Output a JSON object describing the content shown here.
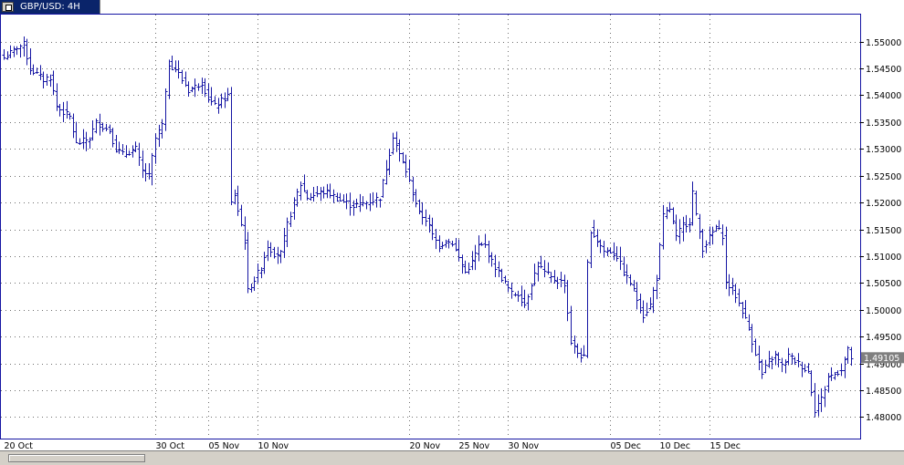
{
  "window": {
    "title": "GBP/USD: 4H"
  },
  "colors": {
    "bars": "#1515a3",
    "grid": "#6f6f6f",
    "frame": "#1515a3",
    "price_box": "#7f7f7f"
  },
  "chart_data": {
    "type": "ohlc",
    "symbol": "GBP/USD",
    "timeframe": "4H",
    "current_price_label": "1.49105",
    "current_price": 1.49105,
    "ylim": [
      1.477,
      1.553
    ],
    "y_ticks": [
      "1.55000",
      "1.54500",
      "1.54000",
      "1.53500",
      "1.53000",
      "1.52500",
      "1.52000",
      "1.51500",
      "1.51000",
      "1.50500",
      "1.50000",
      "1.49500",
      "1.49000",
      "1.48500",
      "1.48000"
    ],
    "x_labels": [
      {
        "label": "20 Oct",
        "bar": 0
      },
      {
        "label": "30 Oct",
        "bar": 46
      },
      {
        "label": "05 Nov",
        "bar": 62
      },
      {
        "label": "10 Nov",
        "bar": 77
      },
      {
        "label": "20 Nov",
        "bar": 123
      },
      {
        "label": "25 Nov",
        "bar": 138
      },
      {
        "label": "30 Nov",
        "bar": 153
      },
      {
        "label": "05 Dec",
        "bar": 184
      },
      {
        "label": "10 Dec",
        "bar": 199
      },
      {
        "label": "15 Dec",
        "bar": 214
      }
    ],
    "close_path": [
      [
        0,
        1.547
      ],
      [
        4,
        1.549
      ],
      [
        6,
        1.5495
      ],
      [
        8,
        1.545
      ],
      [
        12,
        1.543
      ],
      [
        14,
        1.5435
      ],
      [
        16,
        1.538
      ],
      [
        20,
        1.536
      ],
      [
        22,
        1.531
      ],
      [
        26,
        1.532
      ],
      [
        28,
        1.535
      ],
      [
        32,
        1.5335
      ],
      [
        34,
        1.53
      ],
      [
        36,
        1.529
      ],
      [
        40,
        1.53
      ],
      [
        42,
        1.526
      ],
      [
        44,
        1.525
      ],
      [
        46,
        1.532
      ],
      [
        48,
        1.5345
      ],
      [
        50,
        1.546
      ],
      [
        52,
        1.545
      ],
      [
        54,
        1.543
      ],
      [
        56,
        1.541
      ],
      [
        60,
        1.5425
      ],
      [
        62,
        1.5395
      ],
      [
        64,
        1.538
      ],
      [
        68,
        1.54
      ],
      [
        69,
        1.52
      ],
      [
        70,
        1.5215
      ],
      [
        73,
        1.513
      ],
      [
        74,
        1.5035
      ],
      [
        78,
        1.508
      ],
      [
        80,
        1.512
      ],
      [
        82,
        1.5105
      ],
      [
        84,
        1.5105
      ],
      [
        86,
        1.516
      ],
      [
        88,
        1.52
      ],
      [
        90,
        1.5235
      ],
      [
        92,
        1.521
      ],
      [
        96,
        1.522
      ],
      [
        98,
        1.522
      ],
      [
        102,
        1.5205
      ],
      [
        106,
        1.5195
      ],
      [
        110,
        1.52
      ],
      [
        114,
        1.521
      ],
      [
        116,
        1.5265
      ],
      [
        118,
        1.5325
      ],
      [
        120,
        1.529
      ],
      [
        122,
        1.526
      ],
      [
        126,
        1.518
      ],
      [
        128,
        1.517
      ],
      [
        130,
        1.514
      ],
      [
        132,
        1.512
      ],
      [
        134,
        1.513
      ],
      [
        136,
        1.5125
      ],
      [
        140,
        1.507
      ],
      [
        142,
        1.509
      ],
      [
        144,
        1.512
      ],
      [
        146,
        1.512
      ],
      [
        148,
        1.509
      ],
      [
        150,
        1.507
      ],
      [
        154,
        1.503
      ],
      [
        156,
        1.503
      ],
      [
        158,
        1.501
      ],
      [
        160,
        1.505
      ],
      [
        162,
        1.5085
      ],
      [
        164,
        1.507
      ],
      [
        166,
        1.506
      ],
      [
        170,
        1.505
      ],
      [
        172,
        1.494
      ],
      [
        174,
        1.492
      ],
      [
        176,
        1.491
      ],
      [
        177,
        1.5085
      ],
      [
        178,
        1.515
      ],
      [
        180,
        1.513
      ],
      [
        182,
        1.511
      ],
      [
        184,
        1.511
      ],
      [
        186,
        1.51
      ],
      [
        188,
        1.507
      ],
      [
        190,
        1.505
      ],
      [
        192,
        1.502
      ],
      [
        194,
        1.499
      ],
      [
        196,
        1.501
      ],
      [
        198,
        1.506
      ],
      [
        200,
        1.5175
      ],
      [
        202,
        1.519
      ],
      [
        204,
        1.5135
      ],
      [
        206,
        1.516
      ],
      [
        208,
        1.5165
      ],
      [
        209,
        1.522
      ],
      [
        210,
        1.5175
      ],
      [
        212,
        1.5115
      ],
      [
        216,
        1.5155
      ],
      [
        218,
        1.514
      ],
      [
        219,
        1.505
      ],
      [
        221,
        1.504
      ],
      [
        224,
        1.5
      ],
      [
        226,
        1.4965
      ],
      [
        228,
        1.492
      ],
      [
        230,
        1.488
      ],
      [
        232,
        1.4905
      ],
      [
        234,
        1.4915
      ],
      [
        236,
        1.4895
      ],
      [
        238,
        1.4915
      ],
      [
        240,
        1.4905
      ],
      [
        242,
        1.4895
      ],
      [
        244,
        1.4885
      ],
      [
        246,
        1.4815
      ],
      [
        248,
        1.4835
      ],
      [
        250,
        1.4875
      ],
      [
        252,
        1.488
      ],
      [
        254,
        1.489
      ],
      [
        256,
        1.4925
      ],
      [
        257,
        1.49105
      ]
    ]
  }
}
